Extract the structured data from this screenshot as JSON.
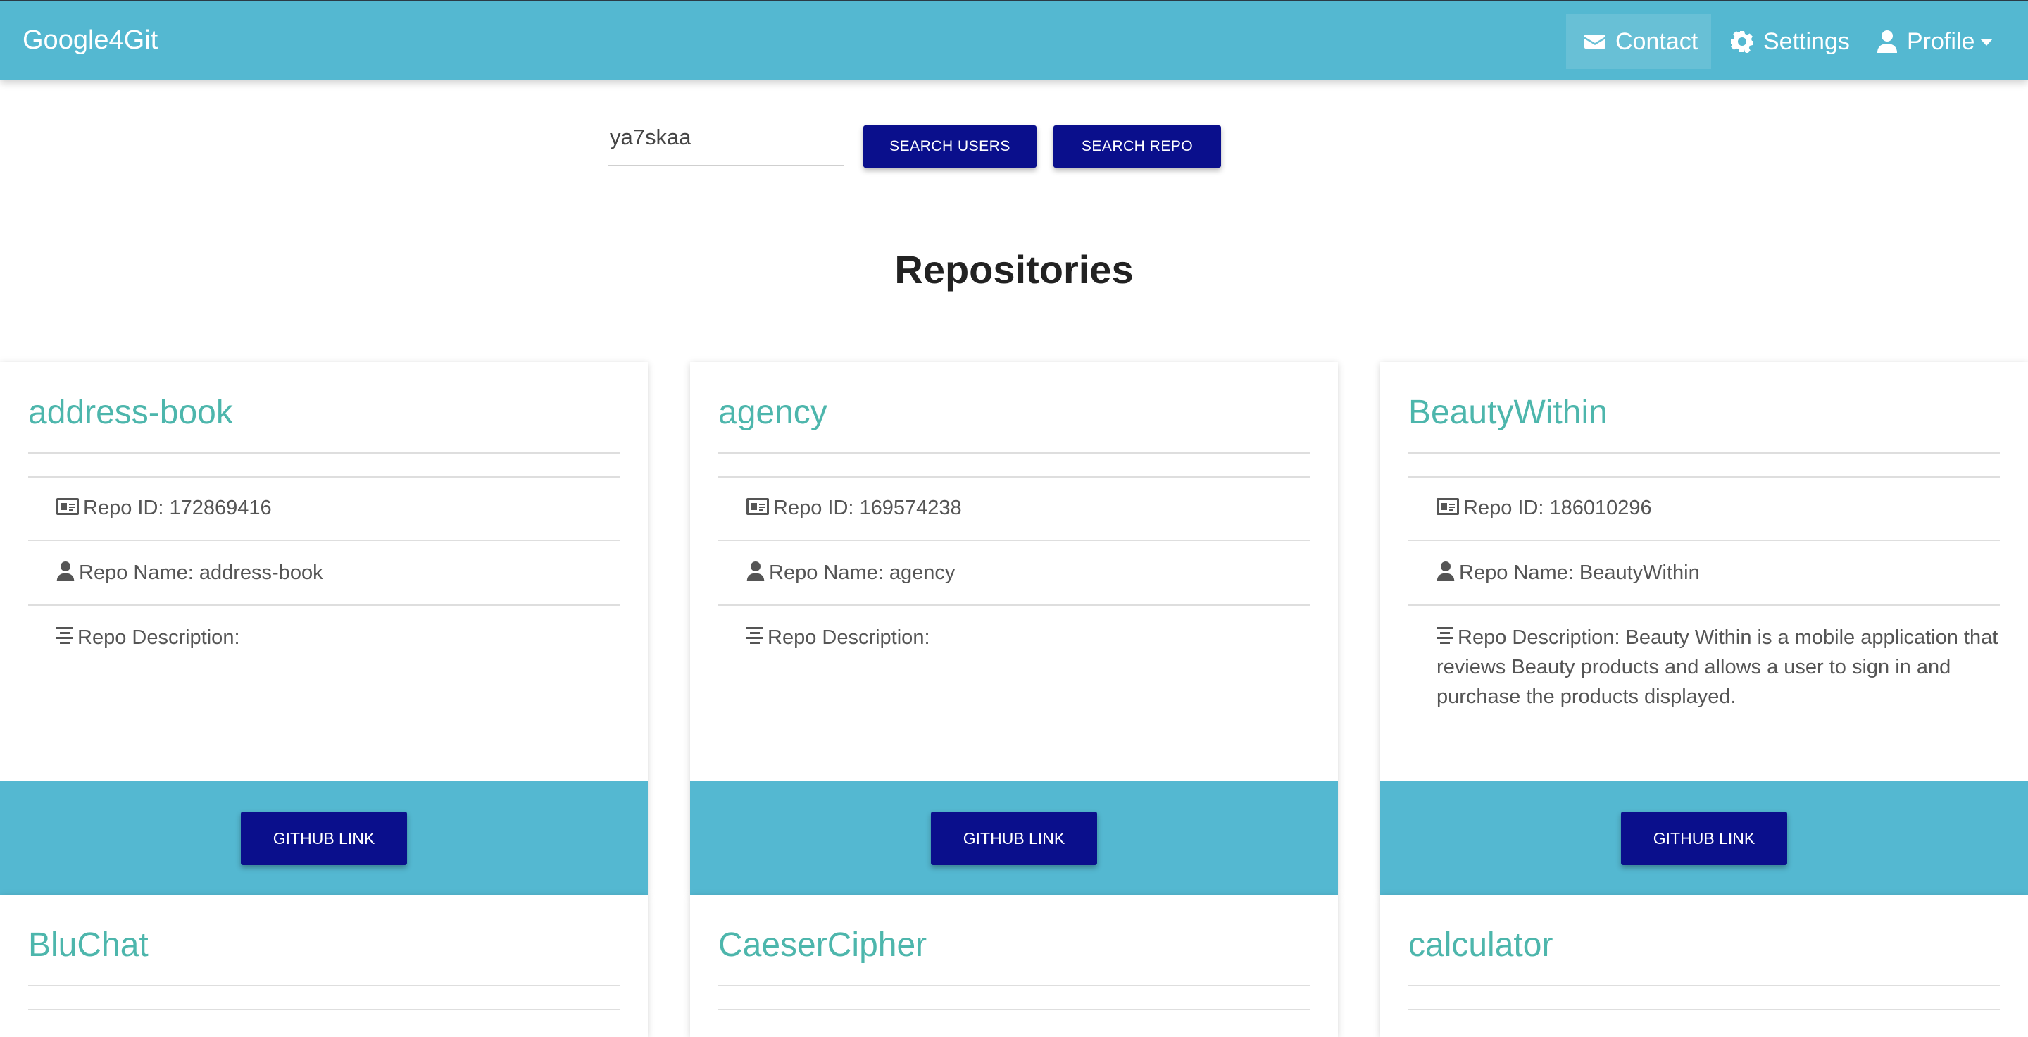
{
  "navbar": {
    "brand": "Google4Git",
    "contact": "Contact",
    "settings": "Settings",
    "profile": "Profile"
  },
  "search": {
    "value": "ya7skaa",
    "search_users_label": "SEARCH USERS",
    "search_repo_label": "SEARCH REPO"
  },
  "page_title": "Repositories",
  "repos": [
    {
      "title": "address-book",
      "id": "Repo ID: 172869416",
      "name": "Repo Name: address-book",
      "desc": "Repo Description:",
      "button": "GITHUB LINK"
    },
    {
      "title": "agency",
      "id": "Repo ID: 169574238",
      "name": "Repo Name: agency",
      "desc": "Repo Description:",
      "button": "GITHUB LINK"
    },
    {
      "title": "BeautyWithin",
      "id": "Repo ID: 186010296",
      "name": "Repo Name: BeautyWithin",
      "desc": "Repo Description: Beauty Within is a mobile application that reviews Beauty products and allows a user to sign in and purchase the products displayed.",
      "button": "GITHUB LINK"
    },
    {
      "title": "BluChat"
    },
    {
      "title": "CaeserCipher"
    },
    {
      "title": "calculator"
    }
  ],
  "colors": {
    "navbar": "#54b8d1",
    "button": "#0a0f8c",
    "card_title": "#4db6ac"
  }
}
